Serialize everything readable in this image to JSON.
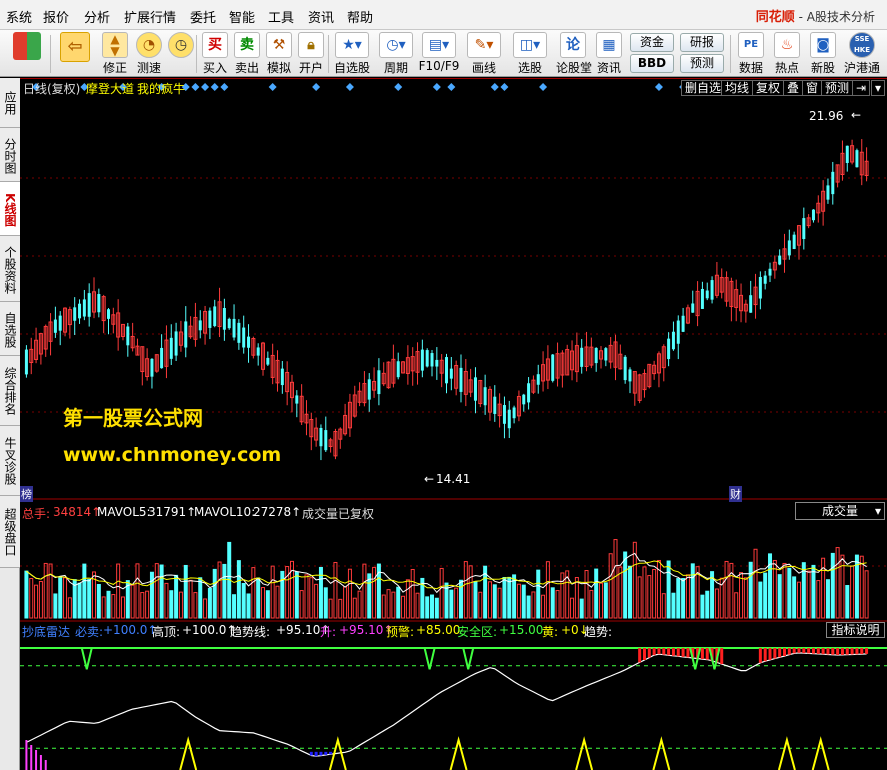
{
  "menu": {
    "items": [
      "系统",
      "报价",
      "分析",
      "扩展行情",
      "委托",
      "智能",
      "工具",
      "资讯",
      "帮助"
    ],
    "brand_logo": "同花顺",
    "brand_text": "- A股技术分析"
  },
  "toolbar": {
    "buttons": [
      {
        "icon": "back-arrow",
        "label": ""
      },
      {
        "icon": "up-down-arrows",
        "label": "修正"
      },
      {
        "icon": "measure",
        "label": "测速"
      },
      {
        "icon": "buy",
        "label": "买入"
      },
      {
        "icon": "sell",
        "label": "卖出"
      },
      {
        "icon": "hammer",
        "label": "模拟"
      },
      {
        "icon": "lock",
        "label": "开户"
      },
      {
        "icon": "star",
        "label": "自选股"
      },
      {
        "icon": "clock",
        "label": "周期"
      },
      {
        "icon": "f10",
        "label": "F10/F9"
      },
      {
        "icon": "pencil",
        "label": "画线"
      },
      {
        "icon": "stock-select",
        "label": "选股"
      },
      {
        "icon": "forum",
        "label": "论股堂"
      },
      {
        "icon": "news",
        "label": "资讯"
      },
      {
        "icon": "data",
        "label": "数据"
      },
      {
        "icon": "hot",
        "label": "热点"
      },
      {
        "icon": "new-stock",
        "label": "新股"
      },
      {
        "icon": "hk-connect",
        "label": "沪港通"
      }
    ],
    "buy_glyph": "买",
    "sell_glyph": "卖",
    "forum_glyph": "论",
    "pe_glyph": "PE",
    "hk_glyph": "SSE HKE",
    "funds_btn": "资金",
    "bbd_btn": "BBD",
    "research_btn": "研报",
    "forecast_btn": "预测"
  },
  "sidebar": {
    "tabs": [
      "应用",
      "分时图",
      "K线图",
      "个股资料",
      "自选股",
      "综合排名",
      "牛叉诊股",
      "超级盘口"
    ],
    "active_index": 2
  },
  "kline": {
    "header_title": "日线(复权)",
    "indicator_1": "摩登大道",
    "indicator_2": "我的疯牛",
    "right_buttons": [
      "删自选",
      "均线",
      "复权",
      "叠",
      "窗",
      "预测"
    ],
    "high_label": "21.96",
    "low_label": "14.41",
    "marker_bang": "榜",
    "marker_cai": "财"
  },
  "volume": {
    "total_label": "总手:",
    "total_value": "34814↑",
    "mavol5_label": "MAVOL5:",
    "mavol5_value": "31791↑",
    "mavol10_label": "MAVOL10:",
    "mavol10_value": "27278↑",
    "note": "成交量已复权",
    "selector": "成交量"
  },
  "indicator": {
    "name": "抄底雷达",
    "sell_label": "必卖:",
    "sell_value": "+100.0↑",
    "top_label": "高顶:",
    "top_value": "+100.0↑",
    "trend_label": "趋势线:",
    "trend_value": "+95.10↑",
    "up_label": "升:",
    "up_value": "+95.10↑",
    "warn_label": "预警:",
    "warn_value": "+85.00",
    "safe_label": "安全区:",
    "safe_value": "+15.00",
    "yellow_label": "黄:",
    "yellow_value": "+0↓",
    "trend2_label": "趋势:",
    "help": "指标说明"
  },
  "watermark": {
    "line1": "第一股票公式网",
    "line2": "www.chnmoney.com"
  },
  "colors": {
    "up": "#ff3b3b",
    "down": "#54ffff",
    "yellow": "#ffff00",
    "diamond": "#4aa8ff",
    "grid_red": "#a00000"
  },
  "chart_data": [
    {
      "type": "candlestick",
      "title": "",
      "ylim": [
        13.8,
        22.8
      ],
      "price_high": 21.96,
      "price_low": 14.41
    },
    {
      "type": "bar",
      "title": "成交量",
      "series": [
        {
          "name": "总手",
          "last": 34814
        },
        {
          "name": "MAVOL5",
          "last": 31791
        },
        {
          "name": "MAVOL10",
          "last": 27278
        }
      ]
    },
    {
      "type": "line",
      "title": "抄底雷达",
      "ylim": [
        0,
        100
      ],
      "reference_lines": {
        "必卖": 100.0,
        "高顶": 100.0,
        "预警": 85.0,
        "安全区": 15.0
      },
      "series": [
        {
          "name": "趋势线",
          "last": 95.1
        },
        {
          "name": "升",
          "last": 95.1
        }
      ]
    }
  ]
}
